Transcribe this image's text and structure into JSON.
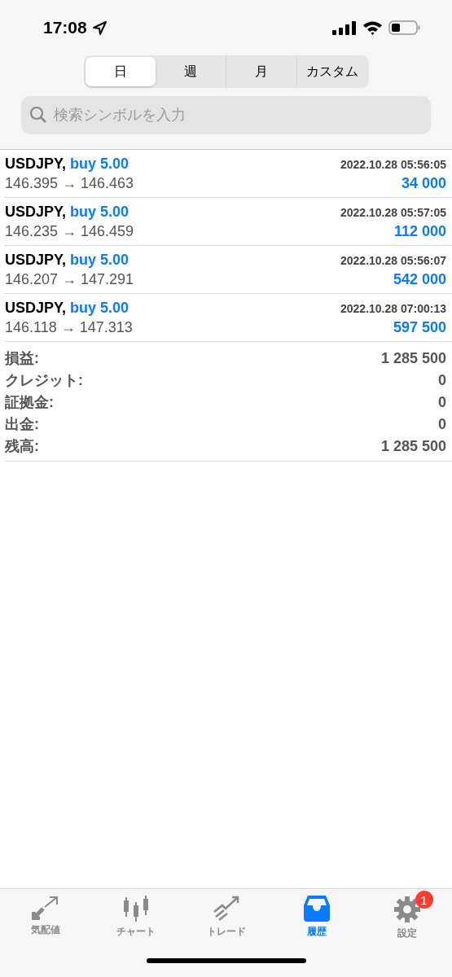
{
  "status_bar": {
    "time": "17:08"
  },
  "segments": [
    {
      "label": "日",
      "selected": true
    },
    {
      "label": "週",
      "selected": false
    },
    {
      "label": "月",
      "selected": false
    },
    {
      "label": "カスタム",
      "selected": false
    }
  ],
  "search": {
    "placeholder": "検索シンボルを入力"
  },
  "trades": [
    {
      "symbol": "USDJPY,",
      "order": "buy 5.00",
      "time": "2022.10.28 05:56:05",
      "prices": "146.395 → 146.463",
      "profit": "34 000"
    },
    {
      "symbol": "USDJPY,",
      "order": "buy 5.00",
      "time": "2022.10.28 05:57:05",
      "prices": "146.235 → 146.459",
      "profit": "112 000"
    },
    {
      "symbol": "USDJPY,",
      "order": "buy 5.00",
      "time": "2022.10.28 05:56:07",
      "prices": "146.207 → 147.291",
      "profit": "542 000"
    },
    {
      "symbol": "USDJPY,",
      "order": "buy 5.00",
      "time": "2022.10.28 07:00:13",
      "prices": "146.118 → 147.313",
      "profit": "597 500"
    }
  ],
  "summary": [
    {
      "label": "損益:",
      "value": "1 285 500"
    },
    {
      "label": "クレジット:",
      "value": "0"
    },
    {
      "label": "証拠金:",
      "value": "0"
    },
    {
      "label": "出金:",
      "value": "0"
    },
    {
      "label": "残高:",
      "value": "1 285 500"
    }
  ],
  "tab_bar": [
    {
      "label": "気配値",
      "selected": false
    },
    {
      "label": "チャート",
      "selected": false
    },
    {
      "label": "トレード",
      "selected": false
    },
    {
      "label": "履歴",
      "selected": true
    },
    {
      "label": "設定",
      "selected": false,
      "badge": "1"
    }
  ]
}
